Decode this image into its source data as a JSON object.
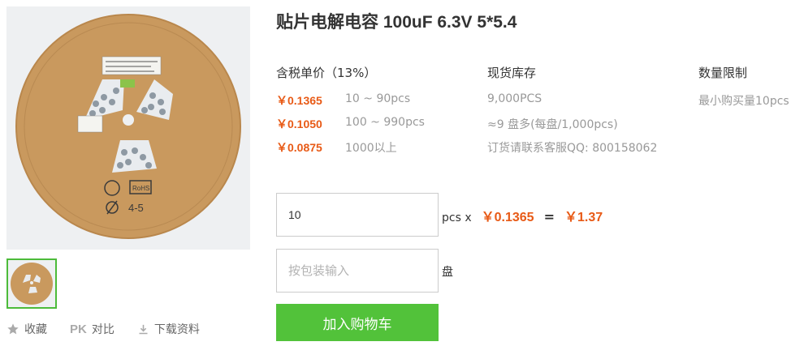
{
  "product": {
    "title": "贴片电解电容 100uF 6.3V 5*5.4",
    "image_alt": "reel of SMD capacitors"
  },
  "pricing": {
    "header": "含税单价（13%）",
    "tiers": [
      {
        "price": "￥0.1365",
        "range": "10 ~ 90pcs"
      },
      {
        "price": "￥0.1050",
        "range": "100 ~ 990pcs"
      },
      {
        "price": "￥0.0875",
        "range": "1000以上"
      }
    ]
  },
  "stock": {
    "header": "现货库存",
    "lines": [
      "9,000PCS",
      "≈9 盘多(每盘/1,000pcs)",
      "订货请联系客服QQ: 800158062"
    ]
  },
  "limit": {
    "header": "数量限制",
    "lines": [
      "最小购买量10pcs"
    ]
  },
  "order": {
    "qty_value": "10",
    "qty_unit": "pcs x",
    "unit_price": "￥0.1365",
    "equals": "=",
    "total": "￥1.37",
    "pack_placeholder": "按包装输入",
    "pack_unit": "盘",
    "add_to_cart": "加入购物车"
  },
  "actions": {
    "favorite": "收藏",
    "compare_icon": "PK",
    "compare": "对比",
    "download": "下载资料"
  },
  "reel_markings": {
    "label1": "4-5",
    "label2": "RoHS"
  },
  "colors": {
    "accent_green": "#52c23a",
    "price_orange": "#e85a16",
    "thumb_border": "#4cbb3a"
  }
}
